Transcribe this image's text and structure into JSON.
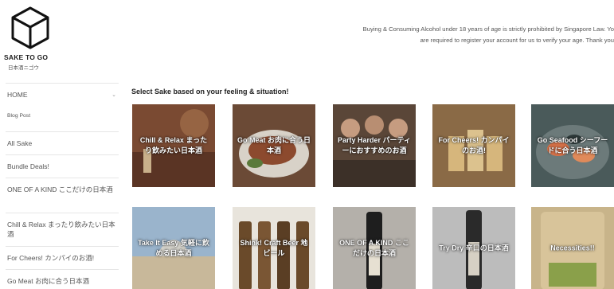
{
  "brand": {
    "name": "SAKE TO GO",
    "subname": "日本酒ニゴウ"
  },
  "notice": {
    "line1": "Buying & Consuming Alcohol under 18 years of age is strictly prohibited by Singapore Law. Yo",
    "line2": "are required to register your account for us to verify your age. Thank you"
  },
  "sidebar": {
    "items": [
      {
        "label": "HOME",
        "chevron": true
      },
      {
        "label": "Blog Post",
        "chevron": false
      },
      {
        "label": "All Sake",
        "chevron": false
      },
      {
        "label": "Bundle Deals!",
        "chevron": false
      },
      {
        "label": "ONE OF A KIND ここだけの日本酒",
        "chevron": false
      },
      {
        "label": "Chill & Relax まったり飲みたい日本酒",
        "chevron": false
      },
      {
        "label": "For Cheers! カンパイのお酒!",
        "chevron": false
      },
      {
        "label": "Go Meat お肉に合う日本酒",
        "chevron": false
      }
    ]
  },
  "main": {
    "heading": "Select Sake based on your feeling & situation!",
    "tiles": [
      {
        "caption": "Chill & Relax まったり飲みたい日本酒",
        "color": "#7a4a32"
      },
      {
        "caption": "Go Meat お肉に合う日本酒",
        "color": "#6b4a36"
      },
      {
        "caption": "Party Harder パーティーにおすすめのお酒",
        "color": "#5a4638"
      },
      {
        "caption": "For Cheers! カンパイのお酒!",
        "color": "#8a6a46"
      },
      {
        "caption": "Go Seafood シーフードに合う日本酒",
        "color": "#4a5a5a"
      },
      {
        "caption": "Take It Easy 気軽に飲める日本酒",
        "color": "#9ab4cc"
      },
      {
        "caption": "Shink! Craft Beer 地ビール",
        "color": "#6a5038"
      },
      {
        "caption": "ONE OF A KIND ここだけの日本酒",
        "color": "#b4b0aa"
      },
      {
        "caption": "Try Dry 辛口の日本酒",
        "color": "#bcbcbc"
      },
      {
        "caption": "Necessities!!",
        "color": "#c8b48a"
      }
    ]
  }
}
